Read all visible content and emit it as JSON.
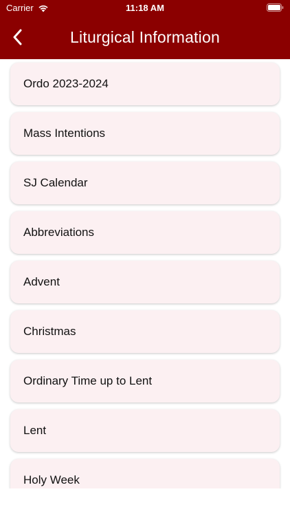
{
  "status_bar": {
    "carrier": "Carrier",
    "time": "11:18 AM"
  },
  "header": {
    "title": "Liturgical Information",
    "back_icon": "chevron-left-icon",
    "background_color": "#8b0000"
  },
  "list": {
    "items": [
      {
        "label": "Ordo 2023-2024"
      },
      {
        "label": "Mass Intentions"
      },
      {
        "label": "SJ Calendar"
      },
      {
        "label": "Abbreviations"
      },
      {
        "label": "Advent"
      },
      {
        "label": "Christmas"
      },
      {
        "label": "Ordinary Time up to Lent"
      },
      {
        "label": "Lent"
      },
      {
        "label": "Holy Week"
      }
    ],
    "item_background": "#fcf0f2"
  }
}
